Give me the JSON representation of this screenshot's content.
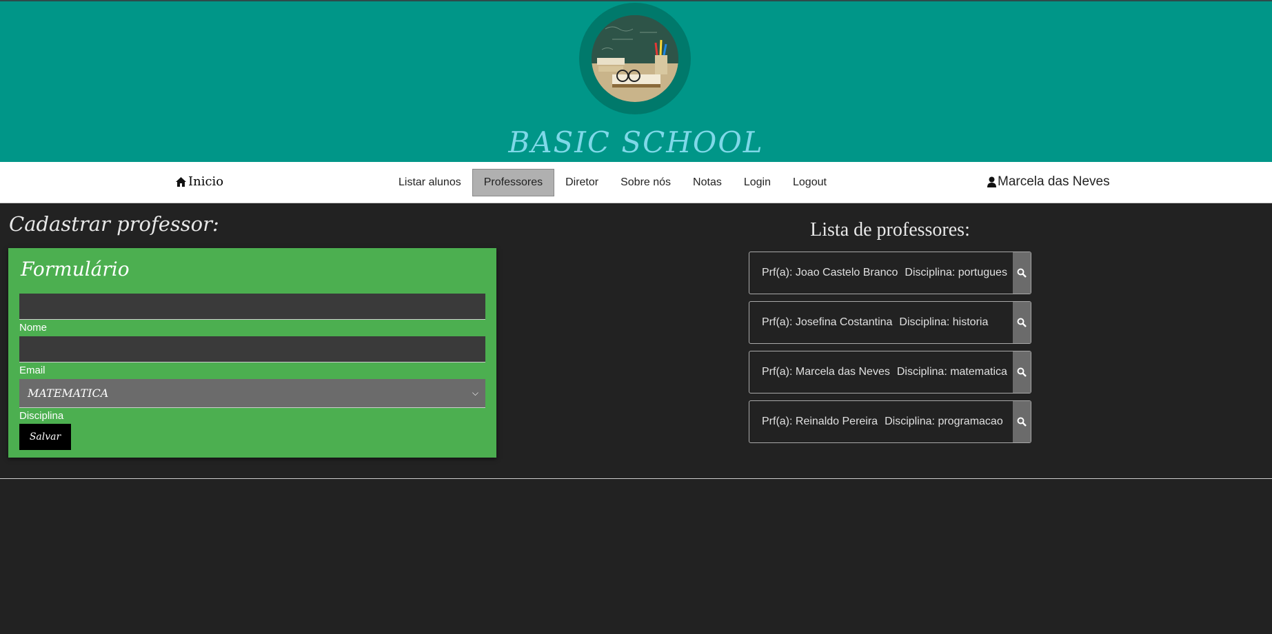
{
  "header": {
    "brand": "BASIC SCHOOL",
    "logo_icon": "school-desk-chalkboard-image"
  },
  "nav": {
    "home_label": "Inicio",
    "home_icon": "home-icon",
    "links": [
      "Listar alunos",
      "Professores",
      "Diretor",
      "Sobre nós",
      "Notas",
      "Login",
      "Logout"
    ],
    "active_link": "Professores",
    "user_name": "Marcela das Neves",
    "user_icon": "user-icon"
  },
  "form": {
    "heading": "Cadastrar professor:",
    "card_title": "Formulário",
    "nome_label": "Nome",
    "nome_value": "",
    "email_label": "Email",
    "email_value": "",
    "disciplina_label": "Disciplina",
    "disciplina_value": "MATEMATICA",
    "save_label": "Salvar"
  },
  "list": {
    "heading": "Lista de professores:",
    "items": [
      {
        "prof": "Prf(a): Joao Castelo Branco",
        "disc": "Disciplina: portugues"
      },
      {
        "prof": "Prf(a): Josefina Costantina",
        "disc": "Disciplina: historia"
      },
      {
        "prof": "Prf(a): Marcela das Neves",
        "disc": "Disciplina: matematica"
      },
      {
        "prof": "Prf(a): Reinaldo Pereira",
        "disc": "Disciplina: programacao"
      }
    ]
  },
  "colors": {
    "banner": "#009688",
    "card": "#4caf50",
    "background": "#222222"
  }
}
